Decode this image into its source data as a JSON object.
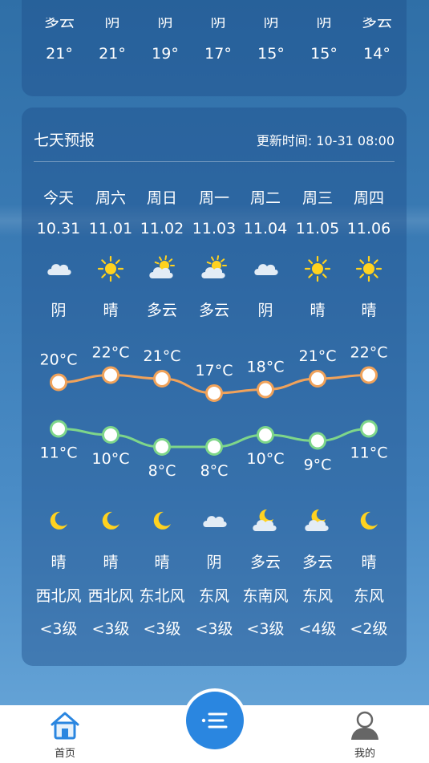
{
  "hourly": {
    "weathers": [
      "多云",
      "阴",
      "阴",
      "阴",
      "阴",
      "阴",
      "多云"
    ],
    "temps": [
      "21°",
      "21°",
      "19°",
      "17°",
      "15°",
      "15°",
      "14°"
    ]
  },
  "forecast": {
    "title": "七天预报",
    "update": "更新时间: 10-31 08:00",
    "days": [
      {
        "day": "今天",
        "date": "10.31",
        "icon": "cloudy-icon",
        "wx": "阴",
        "high": "20°C",
        "low": "11°C",
        "night_icon": "moon-icon",
        "night_wx": "晴",
        "wind": "西北风",
        "level": "<3级",
        "high_val": 20,
        "low_val": 11
      },
      {
        "day": "周六",
        "date": "11.01",
        "icon": "sun-icon",
        "wx": "晴",
        "high": "22°C",
        "low": "10°C",
        "night_icon": "moon-icon",
        "night_wx": "晴",
        "wind": "西北风",
        "level": "<3级",
        "high_val": 22,
        "low_val": 10
      },
      {
        "day": "周日",
        "date": "11.02",
        "icon": "partly-cloudy-icon",
        "wx": "多云",
        "high": "21°C",
        "low": "8°C",
        "night_icon": "moon-icon",
        "night_wx": "晴",
        "wind": "东北风",
        "level": "<3级",
        "high_val": 21,
        "low_val": 8
      },
      {
        "day": "周一",
        "date": "11.03",
        "icon": "partly-cloudy-icon",
        "wx": "多云",
        "high": "17°C",
        "low": "8°C",
        "night_icon": "cloudy-icon",
        "night_wx": "阴",
        "wind": "东风",
        "level": "<3级",
        "high_val": 17,
        "low_val": 8
      },
      {
        "day": "周二",
        "date": "11.04",
        "icon": "cloudy-icon",
        "wx": "阴",
        "high": "18°C",
        "low": "10°C",
        "night_icon": "cloudy-moon-icon",
        "night_wx": "多云",
        "wind": "东南风",
        "level": "<3级",
        "high_val": 18,
        "low_val": 10
      },
      {
        "day": "周三",
        "date": "11.05",
        "icon": "sun-icon",
        "wx": "晴",
        "high": "21°C",
        "low": "9°C",
        "night_icon": "cloudy-moon-icon",
        "night_wx": "多云",
        "wind": "东风",
        "level": "<4级",
        "high_val": 21,
        "low_val": 9
      },
      {
        "day": "周四",
        "date": "11.06",
        "icon": "sun-icon",
        "wx": "晴",
        "high": "22°C",
        "low": "11°C",
        "night_icon": "moon-icon",
        "night_wx": "晴",
        "wind": "东风",
        "level": "<2级",
        "high_val": 22,
        "low_val": 11
      }
    ]
  },
  "colors": {
    "high_line": "#f0a25a",
    "low_line": "#7ed68a",
    "fab": "#2a86e0"
  },
  "tabs": [
    {
      "label": "首页",
      "icon": "home-icon"
    },
    {
      "label": "我的",
      "icon": "user-icon"
    }
  ],
  "fab_icon": "menu-icon"
}
